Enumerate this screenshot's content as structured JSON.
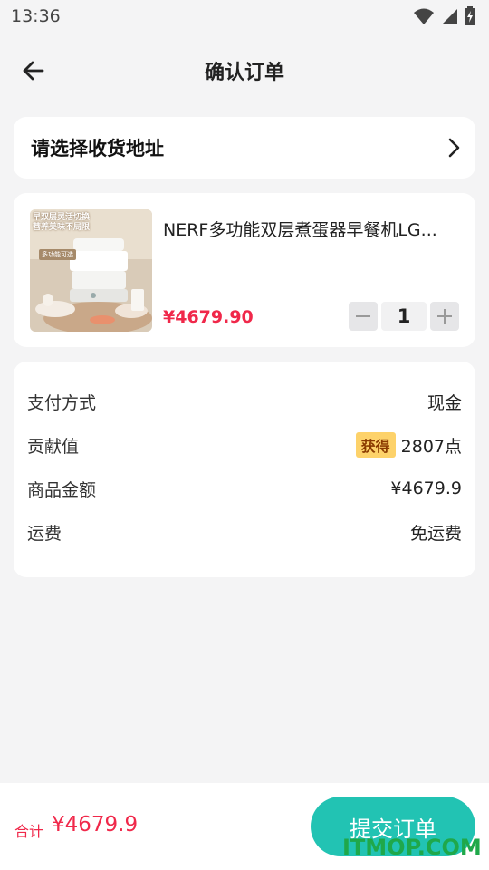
{
  "status_bar": {
    "time": "13:36"
  },
  "header": {
    "title": "确认订单"
  },
  "address": {
    "label": "请选择收货地址"
  },
  "product": {
    "name": "NERF多功能双层煮蛋器早餐机LG...",
    "price": "¥4679.90",
    "quantity": "1",
    "thumb_text_lines": [
      "早双层灵活切换",
      "营养美味不局限",
      "多功能可选"
    ]
  },
  "info": {
    "payment_label": "支付方式",
    "payment_value": "现金",
    "contribution_label": "贡献值",
    "contribution_badge": "获得",
    "contribution_value": "2807点",
    "amount_label": "商品金额",
    "amount_value": "¥4679.9",
    "shipping_label": "运费",
    "shipping_value": "免运费"
  },
  "footer": {
    "total_label": "合计",
    "total_value": "¥4679.9",
    "submit_label": "提交订单"
  },
  "watermark": "ITMOP.COM",
  "colors": {
    "accent": "#22c3b3",
    "price": "#f0284a",
    "badge": "#fdd26a",
    "background": "#f4f4f5"
  }
}
